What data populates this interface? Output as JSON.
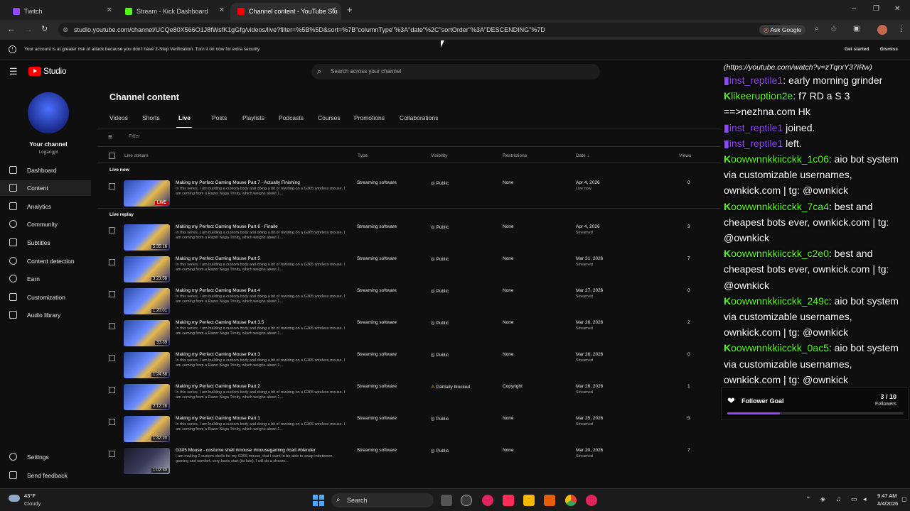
{
  "browser": {
    "tabs": [
      {
        "label": "Twitch",
        "color": "#9146ff"
      },
      {
        "label": "Stream - Kick Dashboard",
        "color": "#53fc18"
      },
      {
        "label": "Channel content - YouTube Stu",
        "color": "#ff0000"
      }
    ],
    "url": "studio.youtube.com/channel/UCQe80X566O1J8fWsfK1gGfg/videos/live?filter=%5B%5D&sort=%7B\"columnType\"%3A\"date\"%2C\"sortOrder\"%3A\"DESCENDING\"%7D",
    "ask_google": "Ask Google"
  },
  "warning": {
    "text": "Your account is at greater risk of attack because you don't have 2-Step Verification. Turn it on now for extra security",
    "get_started": "Get started",
    "dismiss": "Dismiss"
  },
  "studio": {
    "logo": "Studio",
    "search_placeholder": "Search across your channel"
  },
  "sidebar": {
    "channel_label": "Your channel",
    "channel_handle": "Logangpt",
    "items": [
      {
        "label": "Dashboard",
        "icon": "dashboard-icon"
      },
      {
        "label": "Content",
        "icon": "content-icon"
      },
      {
        "label": "Analytics",
        "icon": "analytics-icon"
      },
      {
        "label": "Community",
        "icon": "community-icon"
      },
      {
        "label": "Subtitles",
        "icon": "subtitles-icon"
      },
      {
        "label": "Content detection",
        "icon": "copyright-icon"
      },
      {
        "label": "Earn",
        "icon": "earn-icon"
      },
      {
        "label": "Customization",
        "icon": "customization-icon"
      },
      {
        "label": "Audio library",
        "icon": "audio-library-icon"
      }
    ],
    "settings": "Settings",
    "feedback": "Send feedback"
  },
  "content": {
    "title": "Channel content",
    "tabs": [
      "Videos",
      "Shorts",
      "Live",
      "Posts",
      "Playlists",
      "Podcasts",
      "Courses",
      "Promotions",
      "Collaborations"
    ],
    "filter_label": "Filter",
    "columns": [
      "Live stream",
      "Type",
      "Visibility",
      "Restrictions",
      "Date",
      "Views"
    ],
    "section_live_now": "Live now",
    "section_live_replay": "Live replay",
    "rows": [
      {
        "title": "Making my Perfect Gaming Mouse Part 7 - Actually Finishing",
        "desc": "In this series, I am building a custom body and doing a bit of rewiring on a G305 wireless mouse. I am coming from a Razer Naga Trinity, which weighs about 1...",
        "badge": "LIVE",
        "type": "Streaming software",
        "visibility": "Public",
        "restrictions": "None",
        "date": "Apr 4, 2026",
        "date_sub": "Live now",
        "views": "0"
      },
      {
        "title": "Making my Perfect Gaming Mouse Part 6 - Finalle",
        "desc": "In this series, I am building a custom body and doing a bit of rewiring on a G305 wireless mouse. I am coming from a Razer Naga Trinity, which weighs about 1...",
        "badge": "5:35:16",
        "type": "Streaming software",
        "visibility": "Public",
        "restrictions": "None",
        "date": "Apr 4, 2026",
        "date_sub": "Streamed",
        "views": "3"
      },
      {
        "title": "Making my Perfect Gaming Mouse Part 5",
        "desc": "In this series, I am building a custom body and doing a bit of rewiring on a G305 wireless mouse. I am coming from a Razer Naga Trinity, which weighs about 1...",
        "badge": "3:23:56",
        "type": "Streaming software",
        "visibility": "Public",
        "restrictions": "None",
        "date": "Mar 31, 2026",
        "date_sub": "Streamed",
        "views": "7"
      },
      {
        "title": "Making my Perfect Gaming Mouse Part 4",
        "desc": "In this series, I am building a custom body and doing a bit of rewiring on a G305 wireless mouse. I am coming from a Razer Naga Trinity, which weighs about 1...",
        "badge": "1:20:01",
        "type": "Streaming software",
        "visibility": "Public",
        "restrictions": "None",
        "date": "Mar 27, 2026",
        "date_sub": "Streamed",
        "views": "0"
      },
      {
        "title": "Making my Perfect Gaming Mouse Part 3.5",
        "desc": "In this series, I am building a custom body and doing a bit of rewiring on a G305 wireless mouse. I am coming from a Razer Naga Trinity, which weighs about 1...",
        "badge": "33:39",
        "type": "Streaming software",
        "visibility": "Public",
        "restrictions": "None",
        "date": "Mar 26, 2026",
        "date_sub": "Streamed",
        "views": "2"
      },
      {
        "title": "Making my Perfect Gaming Mouse Part 3",
        "desc": "In this series, I am building a custom body and doing a bit of rewiring on a G305 wireless mouse. I am coming from a Razer Naga Trinity, which weighs about 1...",
        "badge": "1:24:58",
        "type": "Streaming software",
        "visibility": "Public",
        "restrictions": "None",
        "date": "Mar 26, 2026",
        "date_sub": "Streamed",
        "views": "0"
      },
      {
        "title": "Making my Perfect Gaming Mouse Part 2",
        "desc": "In this series, I am building a custom body and doing a bit of rewiring on a G305 wireless mouse. I am coming from a Razer Naga Trinity, which weighs about 1...",
        "badge": "2:12:28",
        "type": "Streaming software",
        "visibility": "Partially blocked",
        "restrictions": "Copyright",
        "date": "Mar 26, 2026",
        "date_sub": "Streamed",
        "views": "1"
      },
      {
        "title": "Making my Perfect Gaming Mouse Part 1",
        "desc": "In this series, I am building a custom body and doing a bit of rewiring on a G305 wireless mouse. I am coming from a Razer Naga Trinity, which weighs about 1...",
        "badge": "1:32:20",
        "type": "Streaming software",
        "visibility": "Public",
        "restrictions": "None",
        "date": "Mar 25, 2026",
        "date_sub": "Streamed",
        "views": "5"
      },
      {
        "title": "G305 Mouse - costume shell #mouse #mousegaming #cad #blender",
        "desc": "I am making 2 custom shells for my G305 mouse, that I want to be able to swap inbetween, gaming and comfort. very basic start (its late), I will do a stream...",
        "badge": "1:02:30",
        "type": "Streaming software",
        "visibility": "Public",
        "restrictions": "None",
        "date": "Mar 20, 2026",
        "date_sub": "Streamed",
        "views": "7"
      }
    ]
  },
  "chat": {
    "top_link": "(https://youtube.com/watch?v=zTqrxY37iRw)",
    "messages": [
      {
        "platform": "twitch",
        "user": "inst_reptile1",
        "text": ": early morning grinder"
      },
      {
        "platform": "kick",
        "user": "likeeruption2e",
        "text": ": f7 RD a S 3 ==>nezhna.com Hk"
      },
      {
        "platform": "twitch",
        "user": "inst_reptile1",
        "text": " joined."
      },
      {
        "platform": "twitch",
        "user": "inst_reptile1",
        "text": " left."
      },
      {
        "platform": "kick",
        "user": "oowwnnkkiicckk_1c06",
        "text": ": aio bot system via customizable usernames, ownkick.com | tg: @ownkick"
      },
      {
        "platform": "kick",
        "user": "oowwnnkkiicckk_7ca4",
        "text": ": best and cheapest bots ever, ownkick.com | tg: @ownkick"
      },
      {
        "platform": "kick",
        "user": "oowwnnkkiicckk_c2e0",
        "text": ": best and cheapest bots ever, ownkick.com | tg: @ownkick"
      },
      {
        "platform": "kick",
        "user": "oowwnnkkiicckk_249c",
        "text": ": aio bot system via customizable usernames, ownkick.com | tg: @ownkick"
      },
      {
        "platform": "kick",
        "user": "oowwnnkkiicckk_0ac5",
        "text": ": aio bot system via customizable usernames, ownkick.com | tg: @ownkick"
      }
    ]
  },
  "follower_goal": {
    "label": "Follower Goal",
    "count": "3 / 10",
    "unit": "Followers",
    "progress": 0.3
  },
  "taskbar": {
    "weather_temp": "43°F",
    "weather_desc": "Cloudy",
    "search": "Search",
    "time": "9:47 AM",
    "date": "4/4/2026"
  }
}
